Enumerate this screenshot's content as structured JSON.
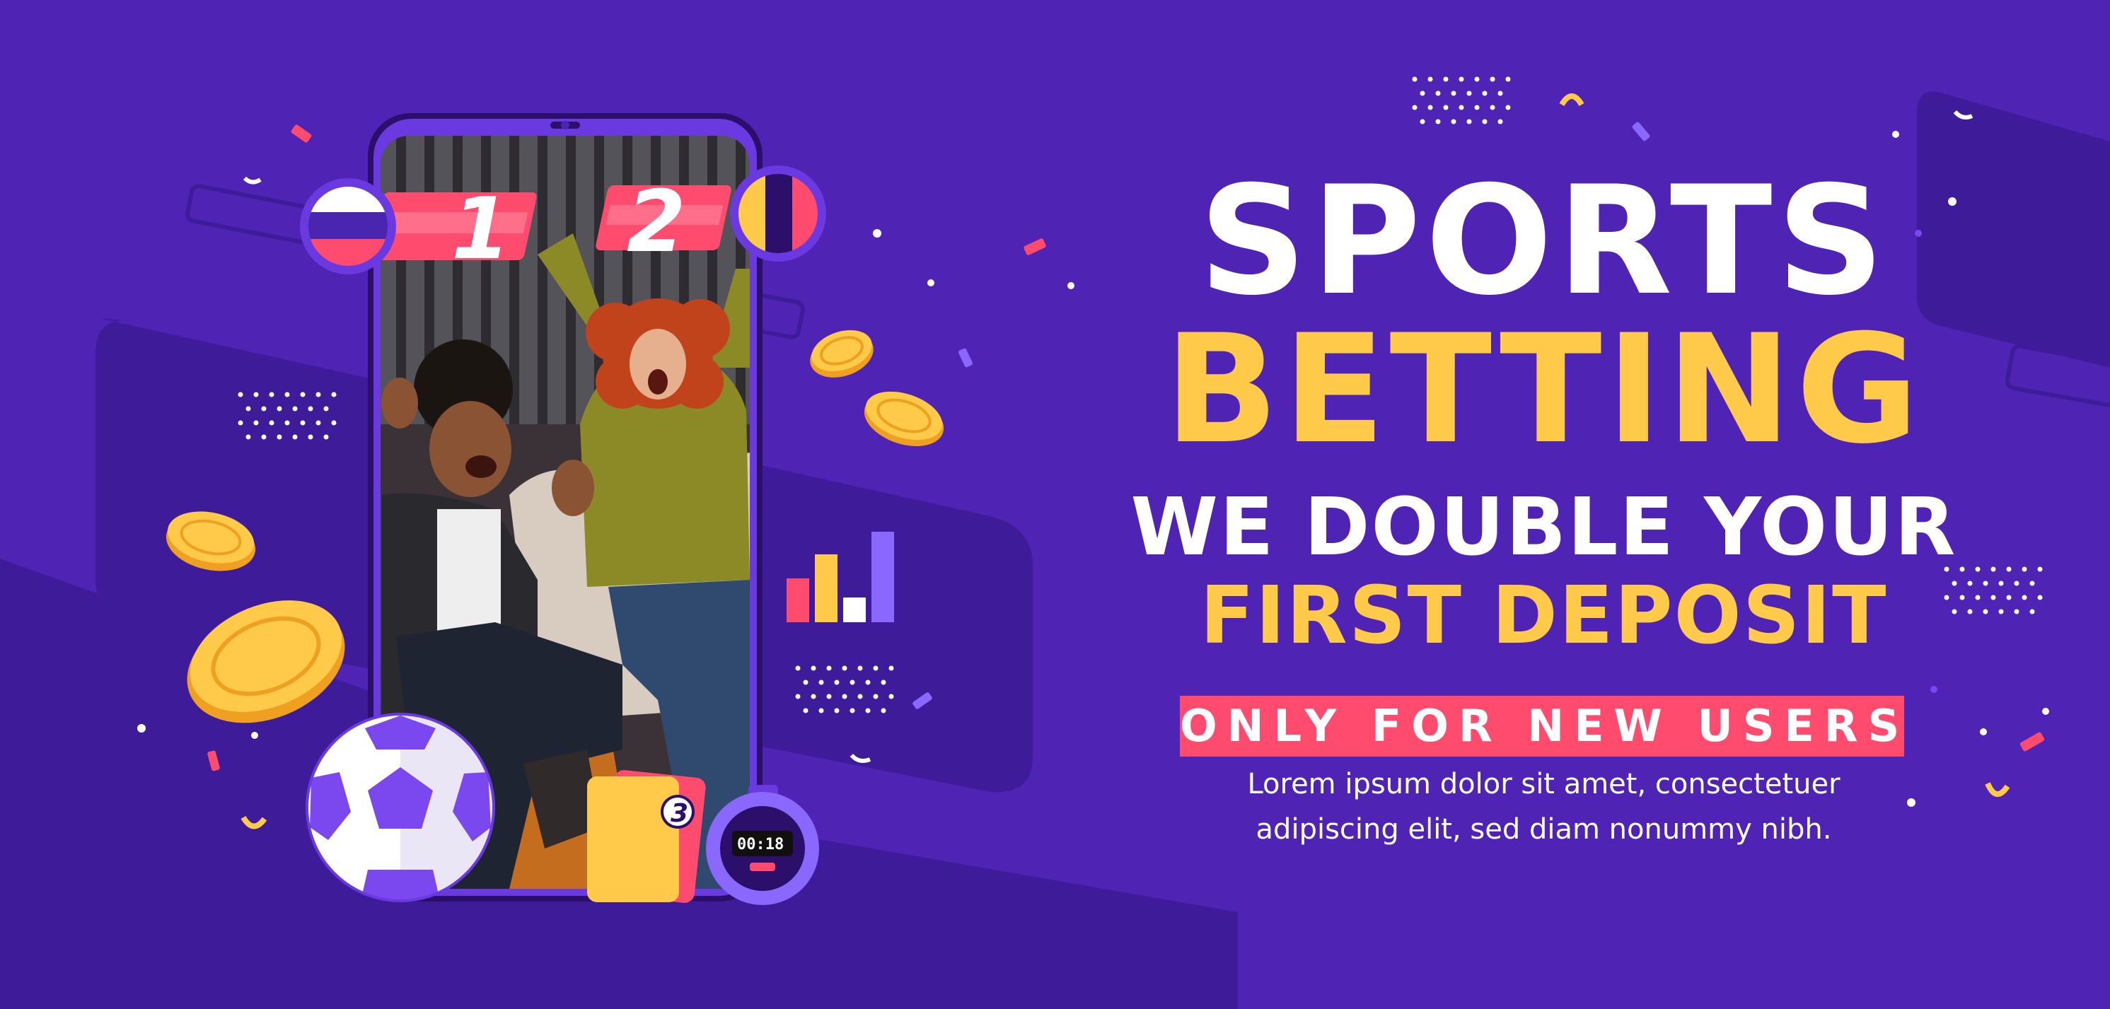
{
  "banner": {
    "title_line1": "SPORTS",
    "title_line2": "BETTING",
    "headline_line1": "WE DOUBLE YOUR",
    "headline_line2": "FIRST DEPOSIT",
    "badge": "ONLY FOR NEW USERS",
    "body_line1": "Lorem ipsum dolor sit amet, consectetuer",
    "body_line2": "adipiscing elit, sed diam nonummy nibh."
  },
  "scoreboard": {
    "team1_score": "1",
    "team2_score": "2",
    "team1_flag": "russia-flag",
    "team2_flag": "tricolor-flag"
  },
  "cards": {
    "card_number": "3"
  },
  "stopwatch": {
    "time": "00:18"
  },
  "icons": [
    "coin-icon",
    "soccer-ball-icon",
    "bar-chart-icon",
    "stopwatch-icon",
    "penalty-cards-icon",
    "confetti-icon"
  ],
  "colors": {
    "background": "#4f23b4",
    "dark_shape": "#3e1b99",
    "accent_yellow": "#ffc94a",
    "accent_pink": "#ff4b6e",
    "accent_purple": "#7b48f0",
    "white": "#ffffff"
  }
}
